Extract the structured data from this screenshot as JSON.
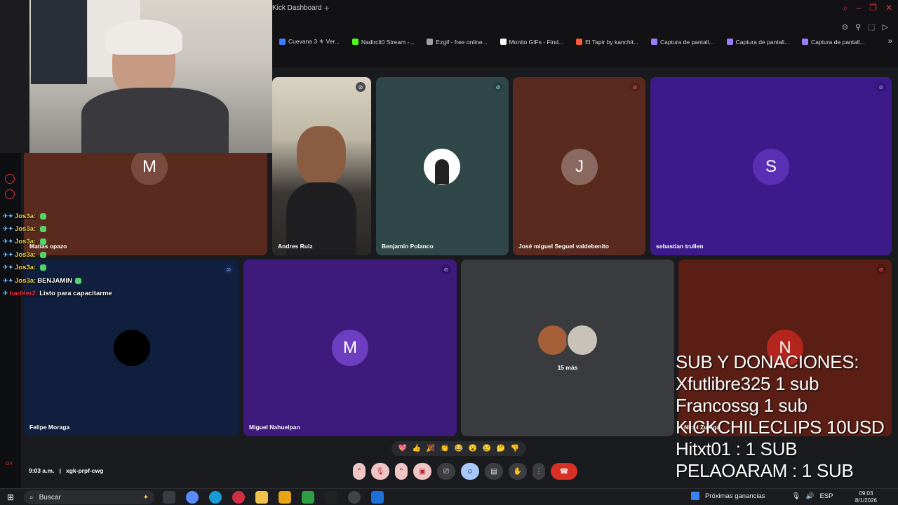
{
  "browser": {
    "tab_title": "Kick Dashboard",
    "new_tab": "+",
    "bookmarks": [
      {
        "label": "Cuevana 3 ⚜ Ver...",
        "color": "#3f7cff"
      },
      {
        "label": "Nadirclt0 Stream -...",
        "color": "#53fc18"
      },
      {
        "label": "Ezgif - free online...",
        "color": "#a0a0a0"
      },
      {
        "label": "Monito GIFs - Find...",
        "color": "#ffffff"
      },
      {
        "label": "El Tapir by kanchit...",
        "color": "#ff5a36"
      },
      {
        "label": "Captura de pantall...",
        "color": "#9b7cff"
      },
      {
        "label": "Captura de pantall...",
        "color": "#9b7cff"
      },
      {
        "label": "Captura de pantall...",
        "color": "#9b7cff"
      }
    ]
  },
  "participants": [
    {
      "name": "Matías opazo",
      "initial": "M",
      "bg": "#5a2a1e",
      "avatar_bg": "#7a4a3e",
      "muted": false
    },
    {
      "name": "Andres Ruiz",
      "initial": "",
      "bg": "#6b5f4d",
      "muted": true
    },
    {
      "name": "Benjamin Polanco",
      "initial": "",
      "bg": "#2f4748",
      "muted": true
    },
    {
      "name": "José miguel Seguel valdebenito",
      "initial": "J",
      "bg": "#5a2a1e",
      "avatar_bg": "#8a6a60",
      "muted": true
    },
    {
      "name": "sebastian trullen",
      "initial": "S",
      "bg": "#3d1a8a",
      "avatar_bg": "#5b2fb3",
      "muted": true
    },
    {
      "name": "Felipe Moraga",
      "initial": "",
      "bg": "#0f1f3d",
      "muted": true
    },
    {
      "name": "Miguel Nahuelpan",
      "initial": "M",
      "bg": "#3e1a7c",
      "avatar_bg": "#6d3fc0",
      "muted": true
    },
    {
      "name": "",
      "initial": "",
      "bg": "#3a3b3f",
      "muted": false
    },
    {
      "name": "Nicol Zuñiga",
      "initial": "N",
      "bg": "#5a1e14",
      "avatar_bg": "#b3261e",
      "muted": true
    }
  ],
  "more_participants": "15 más",
  "chat": [
    {
      "user": "Jos3a:",
      "msg": "",
      "red": false
    },
    {
      "user": "Jos3a:",
      "msg": "",
      "red": false
    },
    {
      "user": "Jos3a:",
      "msg": "",
      "red": false
    },
    {
      "user": "Jos3a:",
      "msg": "",
      "red": false
    },
    {
      "user": "Jos3a:",
      "msg": "",
      "red": false
    },
    {
      "user": "Jos3a:",
      "msg": "BENJAMIN",
      "red": false
    },
    {
      "user": "barbler2:",
      "msg": "Listo para capacitarme",
      "red": true
    }
  ],
  "meeting": {
    "time": "9:03 a.m.",
    "separator": "|",
    "code": "xgk-prpf-cwg"
  },
  "reactions": [
    "💖",
    "👍",
    "🎉",
    "👏",
    "😂",
    "😮",
    "😢",
    "🤔",
    "👎"
  ],
  "overlay": [
    "SUB Y DONACIONES:",
    "Xfutlibre325 1 sub",
    "Francossg 1 sub",
    "KICKCHILECLIPS 10USD",
    "Hitxt01 : 1 SUB",
    "PELAOARAM : 1 SUB"
  ],
  "taskbar": {
    "search_placeholder": "Buscar",
    "earnings": "Próximas ganancias",
    "lang": "ESP",
    "time": "09:03",
    "date": "8/1/2026"
  }
}
